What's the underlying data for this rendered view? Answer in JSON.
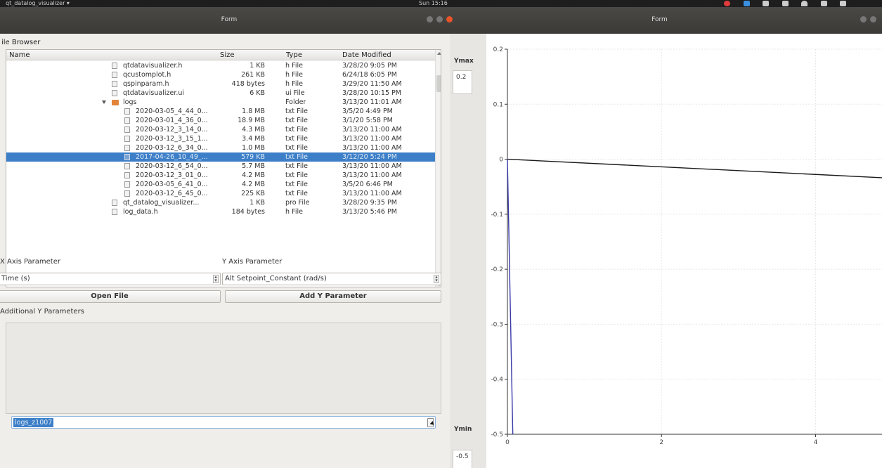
{
  "system_bar": {
    "app_menu": "qt_datalog_visualizer ▾",
    "clock": "Sun 15:16"
  },
  "windows": {
    "left_title": "Form",
    "right_title": "Form"
  },
  "file_browser": {
    "label": "ile Browser",
    "columns": [
      "Name",
      "Size",
      "Type",
      "Date Modified"
    ],
    "rows": [
      {
        "name": "qtdatavisualizer.h",
        "size": "1 KB",
        "type": "h File",
        "date": "3/28/20 9:05 PM",
        "indent": 1,
        "kind": "file"
      },
      {
        "name": "qcustomplot.h",
        "size": "261 KB",
        "type": "h File",
        "date": "6/24/18 6:05 PM",
        "indent": 1,
        "kind": "file"
      },
      {
        "name": "qspinparam.h",
        "size": "418 bytes",
        "type": "h File",
        "date": "3/29/20 11:50 AM",
        "indent": 1,
        "kind": "file"
      },
      {
        "name": "qtdatavisualizer.ui",
        "size": "6 KB",
        "type": "ui File",
        "date": "3/28/20 10:15 PM",
        "indent": 1,
        "kind": "file"
      },
      {
        "name": "logs",
        "size": "",
        "type": "Folder",
        "date": "3/13/20 11:01 AM",
        "indent": 1,
        "kind": "folder"
      },
      {
        "name": "2020-03-05_4_44_0...",
        "size": "1.8 MB",
        "type": "txt File",
        "date": "3/5/20 4:49 PM",
        "indent": 2,
        "kind": "file"
      },
      {
        "name": "2020-03-01_4_36_0...",
        "size": "18.9 MB",
        "type": "txt File",
        "date": "3/1/20 5:58 PM",
        "indent": 2,
        "kind": "file"
      },
      {
        "name": "2020-03-12_3_14_0...",
        "size": "4.3 MB",
        "type": "txt File",
        "date": "3/13/20 11:00 AM",
        "indent": 2,
        "kind": "file"
      },
      {
        "name": "2020-03-12_3_15_1...",
        "size": "3.4 MB",
        "type": "txt File",
        "date": "3/13/20 11:00 AM",
        "indent": 2,
        "kind": "file"
      },
      {
        "name": "2020-03-12_6_34_0...",
        "size": "1.0 MB",
        "type": "txt File",
        "date": "3/13/20 11:00 AM",
        "indent": 2,
        "kind": "file"
      },
      {
        "name": "2017-04-26_10_49_...",
        "size": "579 KB",
        "type": "txt File",
        "date": "3/12/20 5:24 PM",
        "indent": 2,
        "kind": "file",
        "selected": true
      },
      {
        "name": "2020-03-12_6_54_0...",
        "size": "5.7 MB",
        "type": "txt File",
        "date": "3/13/20 11:00 AM",
        "indent": 2,
        "kind": "file"
      },
      {
        "name": "2020-03-12_3_01_0...",
        "size": "4.2 MB",
        "type": "txt File",
        "date": "3/13/20 11:00 AM",
        "indent": 2,
        "kind": "file"
      },
      {
        "name": "2020-03-05_6_41_0...",
        "size": "4.2 MB",
        "type": "txt File",
        "date": "3/5/20 6:46 PM",
        "indent": 2,
        "kind": "file"
      },
      {
        "name": "2020-03-12_6_45_0...",
        "size": "225 KB",
        "type": "txt File",
        "date": "3/13/20 11:00 AM",
        "indent": 2,
        "kind": "file"
      },
      {
        "name": "qt_datalog_visualizer...",
        "size": "1 KB",
        "type": "pro File",
        "date": "3/28/20 9:35 PM",
        "indent": 1,
        "kind": "file"
      },
      {
        "name": "log_data.h",
        "size": "184 bytes",
        "type": "h File",
        "date": "3/13/20 5:46 PM",
        "indent": 1,
        "kind": "file"
      }
    ]
  },
  "x_axis": {
    "label": "X Axis Parameter",
    "value": "Time (s)"
  },
  "y_axis": {
    "label": "Y Axis Parameter",
    "value": "Alt Setpoint_Constant (rad/s)"
  },
  "buttons": {
    "open_file": "Open File",
    "add_y": "Add Y Parameter"
  },
  "additional": {
    "label": "Additional Y Parameters",
    "param_value": "logs_z1007"
  },
  "plot_controls": {
    "ymax_label": "Ymax",
    "ymax_value": "0.2",
    "ymin_label": "Ymin",
    "ymin_value": "-0.5"
  },
  "chart_data": {
    "type": "line",
    "xlim": [
      0,
      5.2
    ],
    "ylim": [
      -0.5,
      0.2
    ],
    "xticks": [
      "0",
      "2",
      "4"
    ],
    "yticks": [
      "0.2",
      "0.1",
      "0",
      "-0.1",
      "-0.2",
      "-0.3",
      "-0.4",
      "-0.5"
    ],
    "grid": true,
    "series": [
      {
        "color": "#1a1a1a",
        "x": [
          0,
          5.2
        ],
        "y": [
          0,
          -0.036
        ]
      },
      {
        "color": "#3a3aa8",
        "x": [
          0,
          0.07
        ],
        "y": [
          0,
          -0.5
        ]
      }
    ]
  }
}
